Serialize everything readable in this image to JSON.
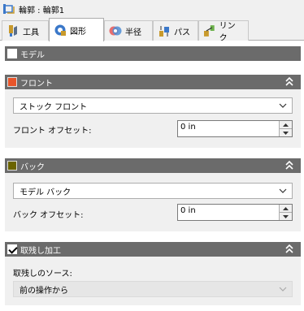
{
  "window": {
    "title": "輪郭 : 輪郭1"
  },
  "tabs": [
    {
      "label": "工具",
      "icon": "tool-icon"
    },
    {
      "label": "図形",
      "icon": "geometry-icon",
      "active": true
    },
    {
      "label": "半径",
      "icon": "radius-icon"
    },
    {
      "label": "パス",
      "icon": "path-icon"
    },
    {
      "label": "リンク",
      "icon": "link-icon"
    }
  ],
  "model_section": {
    "label": "モデル",
    "checked": false
  },
  "front_section": {
    "label": "フロント",
    "color": "#e8552a",
    "dropdown_value": "ストック フロント",
    "offset_label": "フロント オフセット:",
    "offset_value": "0 in"
  },
  "back_section": {
    "label": "バック",
    "color": "#6b6400",
    "dropdown_value": "モデル バック",
    "offset_label": "バック オフセット:",
    "offset_value": "0 in"
  },
  "rest_section": {
    "label": "取残し加工",
    "checked": true,
    "source_label": "取残しのソース:",
    "source_value": "前の操作から"
  }
}
